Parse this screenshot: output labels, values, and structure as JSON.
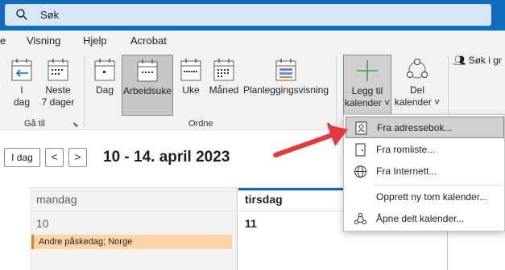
{
  "search": {
    "placeholder": "Søk"
  },
  "menu": [
    "e",
    "Visning",
    "Hjelp",
    "Acrobat"
  ],
  "ribbon": {
    "goto": {
      "today_label": "I\ndag",
      "next7_label": "Neste\n7 dager",
      "group_label": "Gå til"
    },
    "arrange": {
      "day": "Dag",
      "workweek": "Arbeidsuke",
      "week": "Uke",
      "month": "Måned",
      "schedule": "Planleggingsvisning",
      "group_label": "Ordne"
    },
    "add_calendar": "Legg til\nkalender ˅",
    "share_calendar": "Del\nkalender ˅",
    "search_people": "Søk i gr"
  },
  "datenav": {
    "today_button": "I dag",
    "prev": "<",
    "next": ">",
    "range_title": "10 - 14. april 2023"
  },
  "days": [
    {
      "name": "mandag",
      "num": "10"
    },
    {
      "name": "tirsdag",
      "num": "11"
    }
  ],
  "event": {
    "title": "Andre påskedag; Norge"
  },
  "dropdown": {
    "items": [
      {
        "label": "Fra adressebok...",
        "icon": "address-book-icon"
      },
      {
        "label": "Fra romliste...",
        "icon": "room-list-icon"
      },
      {
        "label": "Fra Internett...",
        "icon": "globe-icon"
      },
      {
        "label": "Opprett ny tom kalender...",
        "icon": ""
      },
      {
        "label": "Åpne delt kalender...",
        "icon": "share-network-icon"
      }
    ]
  },
  "colors": {
    "accent": "#0f6cbd",
    "event_fill": "#fcd4a6",
    "arrow": "#e8383d"
  }
}
